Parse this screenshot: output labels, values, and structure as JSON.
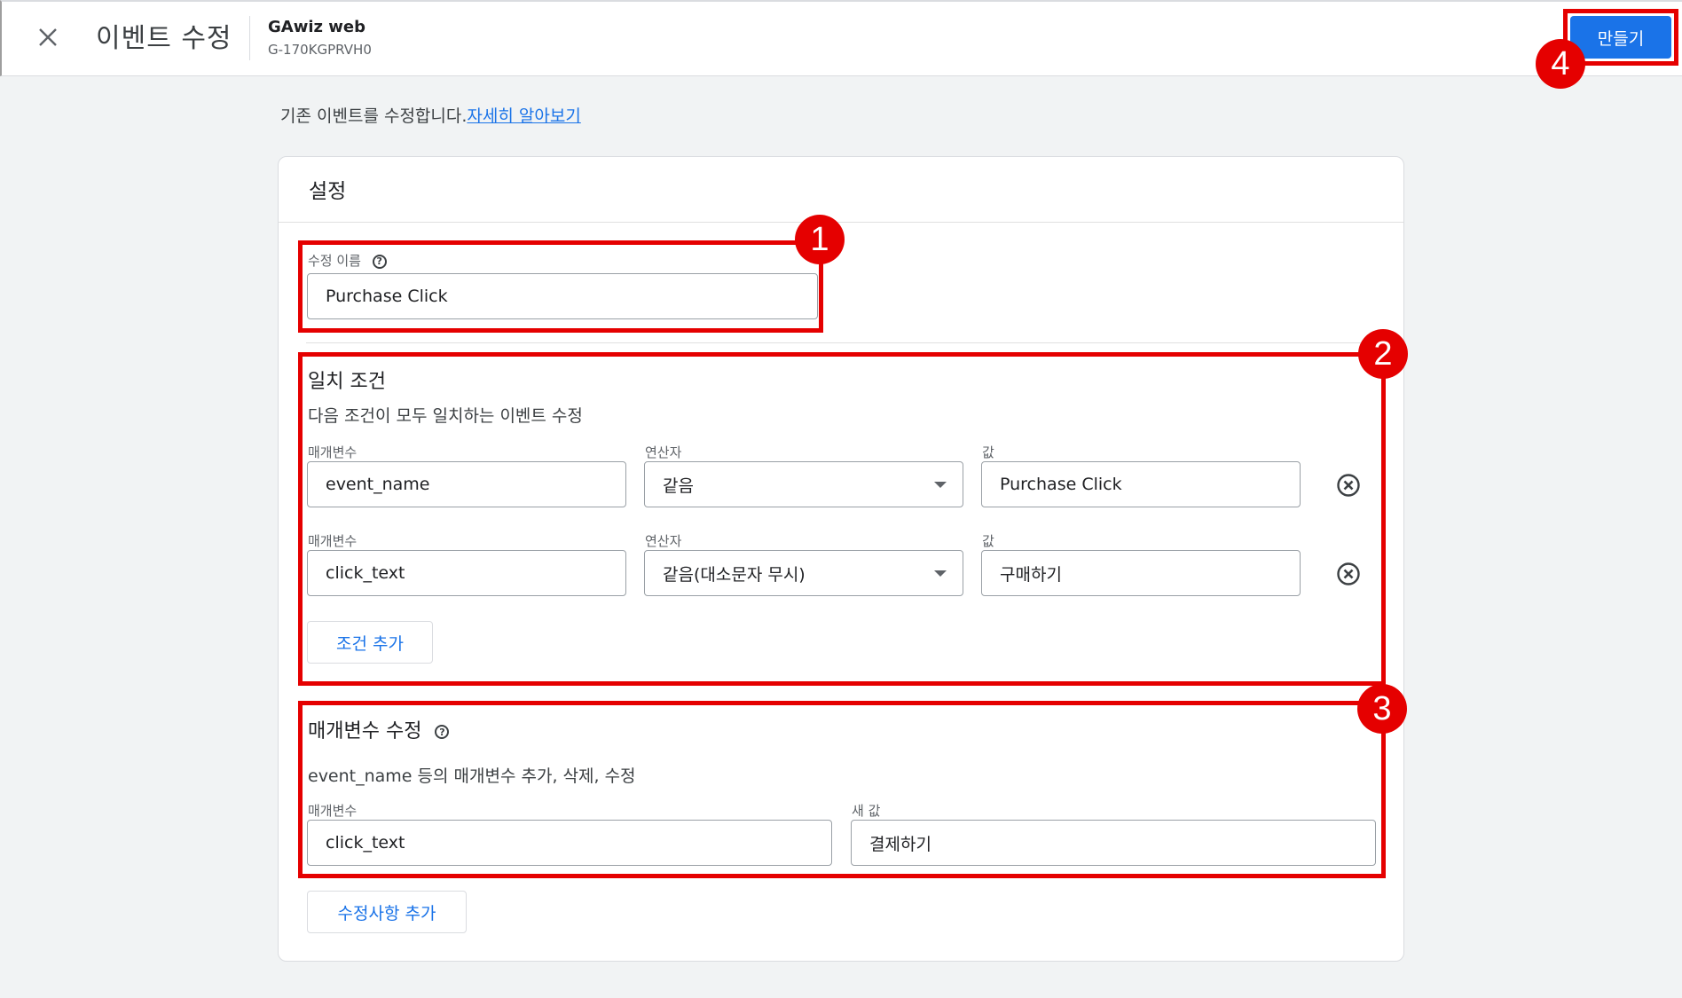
{
  "header": {
    "title": "이벤트 수정",
    "property_name": "GAwiz web",
    "property_id": "G-170KGPRVH0",
    "create_label": "만들기"
  },
  "intro": {
    "text": "기존 이벤트를 수정합니다.",
    "link": "자세히 알아보기"
  },
  "settings": {
    "title": "설정",
    "modification_name_label": "수정 이름",
    "modification_name_value": "Purchase Click"
  },
  "match_conditions": {
    "title": "일치 조건",
    "subtitle": "다음 조건이 모두 일치하는 이벤트 수정",
    "rows": [
      {
        "param_label": "매개변수",
        "param_value": "event_name",
        "operator_label": "연산자",
        "operator_value": "같음",
        "value_label": "값",
        "value": "Purchase Click"
      },
      {
        "param_label": "매개변수",
        "param_value": "click_text",
        "operator_label": "연산자",
        "operator_value": "같음(대소문자 무시)",
        "value_label": "값",
        "value": "구매하기"
      }
    ],
    "add_condition_label": "조건 추가"
  },
  "parameter_modifications": {
    "title": "매개변수 수정",
    "subtitle": "event_name 등의 매개변수 추가, 삭제, 수정",
    "param_label": "매개변수",
    "param_value": "click_text",
    "new_value_label": "새 값",
    "new_value": "결제하기",
    "add_modification_label": "수정사항 추가"
  },
  "annotations": {
    "badges": [
      "1",
      "2",
      "3",
      "4"
    ],
    "color": "#e50000"
  },
  "colors": {
    "primary": "#1a73e8",
    "background": "#f1f3f4"
  }
}
